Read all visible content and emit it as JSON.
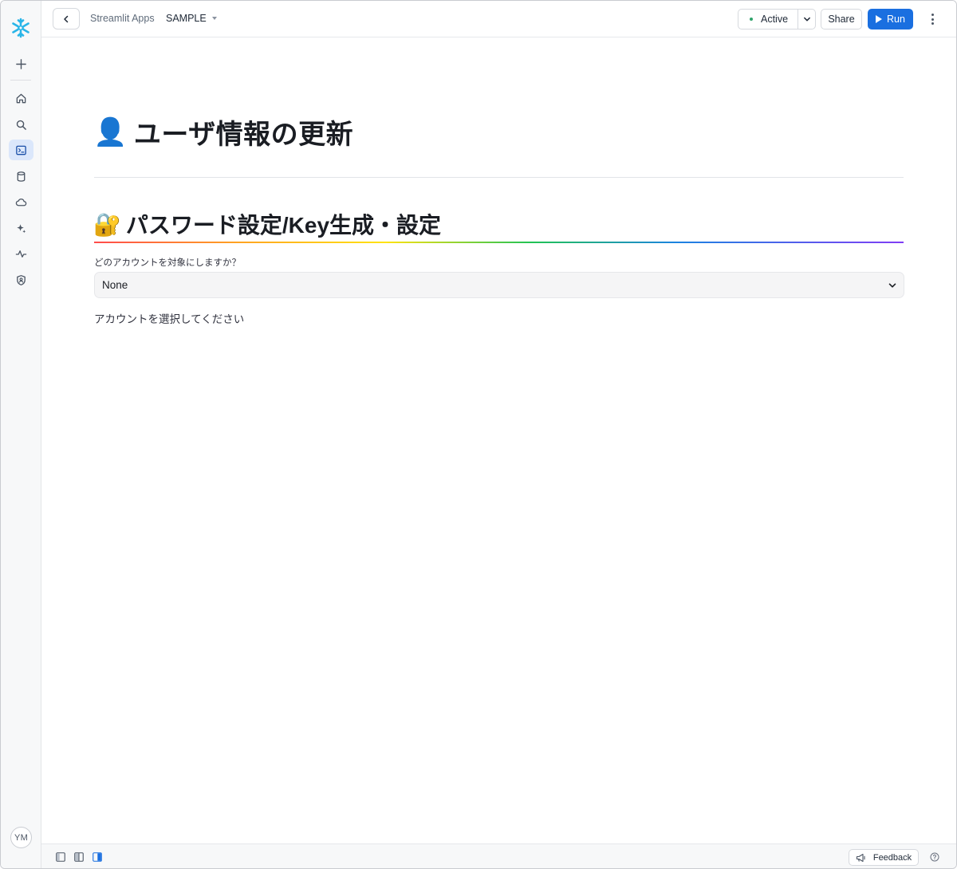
{
  "rail": {
    "items": [
      {
        "name": "add-icon"
      },
      {
        "name": "home-icon"
      },
      {
        "name": "search-icon"
      },
      {
        "name": "terminal-icon",
        "active": true
      },
      {
        "name": "database-icon"
      },
      {
        "name": "cloud-icon"
      },
      {
        "name": "sparkle-icon"
      },
      {
        "name": "activity-icon"
      },
      {
        "name": "shield-icon"
      }
    ],
    "avatar_initials": "YM"
  },
  "topbar": {
    "breadcrumb": "Streamlit Apps",
    "app_name": "SAMPLE",
    "status_label": "Active",
    "share_label": "Share",
    "run_label": "Run"
  },
  "content": {
    "title_emoji": "👤",
    "title": "ユーザ情報の更新",
    "section_emoji": "🔐",
    "section_title": "パスワード設定/Key生成・設定",
    "select_label": "どのアカウントを対象にしますか？",
    "select_value": "None",
    "info_text": "アカウントを選択してください"
  },
  "bottombar": {
    "feedback_label": "Feedback"
  },
  "colors": {
    "accent": "#1a6fe0",
    "status_dot": "#2fa36b",
    "snowflake": "#29b5e8"
  }
}
